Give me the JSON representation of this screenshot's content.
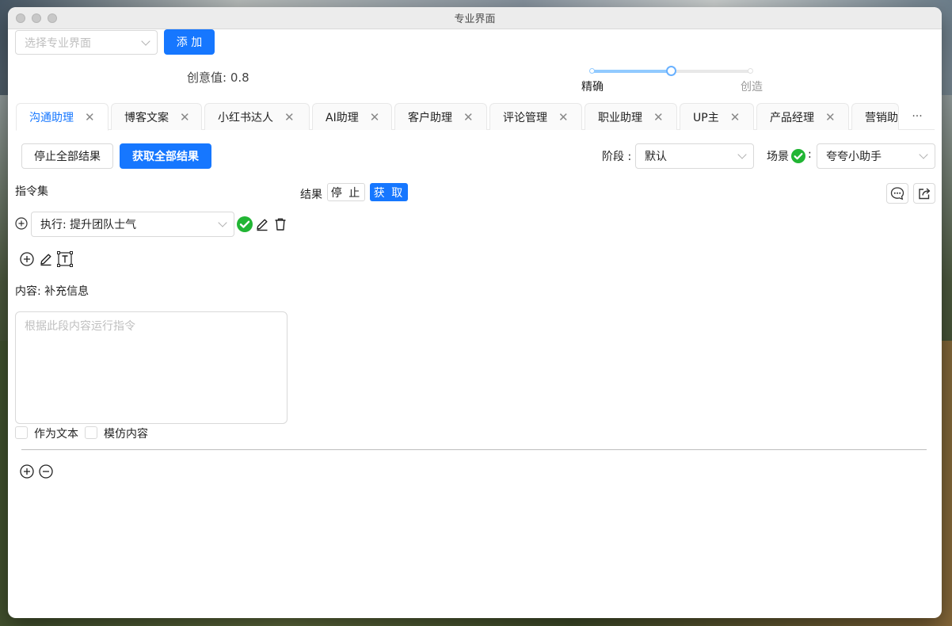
{
  "window": {
    "title": "专业界面"
  },
  "top": {
    "select_placeholder": "选择专业界面",
    "add_button": "添 加",
    "creativity_label": "创意值: 0.8",
    "creativity_value": 0.8,
    "slider_left_label": "精确",
    "slider_right_label": "创造"
  },
  "tabs": [
    {
      "label": "沟通助理",
      "active": true
    },
    {
      "label": "博客文案"
    },
    {
      "label": "小红书达人"
    },
    {
      "label": "AI助理"
    },
    {
      "label": "客户助理"
    },
    {
      "label": "评论管理"
    },
    {
      "label": "职业助理"
    },
    {
      "label": "UP主"
    },
    {
      "label": "产品经理"
    },
    {
      "label": "营销助理"
    }
  ],
  "tab_more": "···",
  "toolbar": {
    "stop_all": "停止全部结果",
    "get_all": "获取全部结果",
    "stage_label": "阶段 :",
    "stage_value": "默认",
    "scene_label": "场景",
    "scene_colon": ":",
    "scene_value": "夸夸小助手"
  },
  "commands": {
    "heading": "指令集",
    "command_value": "执行: 提升团队士气",
    "content_label": "内容: 补充信息",
    "textarea_placeholder": "根据此段内容运行指令",
    "as_text_label": "作为文本",
    "imitate_label": "模仿内容"
  },
  "results": {
    "label": "结果",
    "stop": "停 止",
    "fetch": "获 取"
  },
  "colors": {
    "primary": "#1677ff",
    "success": "#21b534"
  }
}
